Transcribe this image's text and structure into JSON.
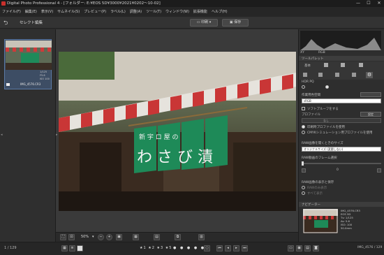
{
  "window": {
    "title": "Digital Photo Professional 4 - [フォルダー: E:¥EOS 5D¥3000¥2021¥0202～10-02]",
    "minimize": "—",
    "maximize": "☐",
    "close": "✕"
  },
  "menu": [
    "ファイル(F)",
    "編集(E)",
    "表示(V)",
    "サムネイル(S)",
    "プレビュー(P)",
    "ラベル(L)",
    "調整(A)",
    "ツール(T)",
    "ウィンドウ(W)",
    "拡張機能",
    "ヘルプ(H)"
  ],
  "toolbar": {
    "mode_label": "セレクト編集",
    "print_label": "印刷",
    "save_label": "保存"
  },
  "thumbnail": {
    "filename": "IMG_4576.CR3",
    "info_top": "1/125",
    "info_mid": "F5.6",
    "info_bot": "ISO 100"
  },
  "photo": {
    "curtain_text_top": "新 宇 ロ 屋 の",
    "curtain_text_big": "わ さ び 漬"
  },
  "right": {
    "histogram_label": "RGB",
    "hist_mode": "XY",
    "panel_title": "ツールパレット",
    "tabs": [
      "基本",
      "トーン",
      "色",
      "詳細",
      "レンズ",
      "設定"
    ],
    "hdr_label": "HDR PQ",
    "color_space_label": "作業用色空間",
    "color_space_value": "sRGB",
    "softproof_label": "ソフトプルーフをする",
    "profile_label": "プロファイル",
    "profile_set": "設定",
    "profile_value": "なし",
    "use_printer_profile": "印刷時プロファイルを使用",
    "use_cms_profile": "CMYKシミュレーション用プロファイルを使用",
    "raw_size_label": "RAW画像を開くときのサイズ",
    "raw_size_value": "オリジナルサイズ (変更しない)",
    "raw_frame_label": "RAW動画のフレーム選択",
    "raw_frame_value": "0",
    "raw_save_label": "RAW画像の表示と保存",
    "raw_opt1": "RAWのみ表示",
    "raw_opt2": "すべて表示",
    "navigator_title": "ナビゲーター",
    "nav_info": [
      "IMG_4576.CR3",
      "EOS 5D",
      "Tv: 1/125",
      "Av: 5.6",
      "ISO: 100",
      "50.0mm"
    ]
  },
  "bottom": {
    "zoom": "50%"
  },
  "status": {
    "count": "1 / 129",
    "right_count": "IMG_4576 / 129"
  }
}
